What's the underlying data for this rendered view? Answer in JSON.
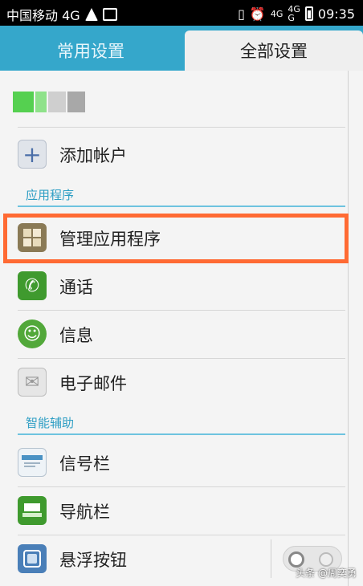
{
  "status_bar": {
    "carrier": "中国移动 4G",
    "network_left": "4G",
    "network_right_top": "4G",
    "network_right_sub": "G",
    "time": "09:35"
  },
  "tabs": [
    {
      "label": "常用设置",
      "active": false
    },
    {
      "label": "全部设置",
      "active": true
    }
  ],
  "account_blur_colors": [
    "#55d050",
    "#8fe28a",
    "#cfcfcf",
    "#a8a8a8"
  ],
  "add_account": {
    "label": "添加帐户",
    "icon": "plus-icon"
  },
  "sections": {
    "apps": "应用程序",
    "assist": "智能辅助"
  },
  "apps_items": [
    {
      "label": "管理应用程序",
      "icon": "manage-apps-icon",
      "color": "#8a7a56"
    },
    {
      "label": "通话",
      "icon": "phone-icon",
      "color": "#3f9a2e"
    },
    {
      "label": "信息",
      "icon": "message-icon",
      "color": "#52a83a"
    },
    {
      "label": "电子邮件",
      "icon": "email-icon",
      "color": "#d9d9d9"
    }
  ],
  "assist_items": [
    {
      "label": "信号栏",
      "icon": "signal-bar-icon",
      "color": "#4a92c4"
    },
    {
      "label": "导航栏",
      "icon": "navigation-bar-icon",
      "color": "#3f9a2e"
    },
    {
      "label": "悬浮按钮",
      "icon": "floating-button-icon",
      "color": "#4a7fb8"
    }
  ],
  "highlight_color": "#ff6a33",
  "watermark": "头条 @周奕勇"
}
